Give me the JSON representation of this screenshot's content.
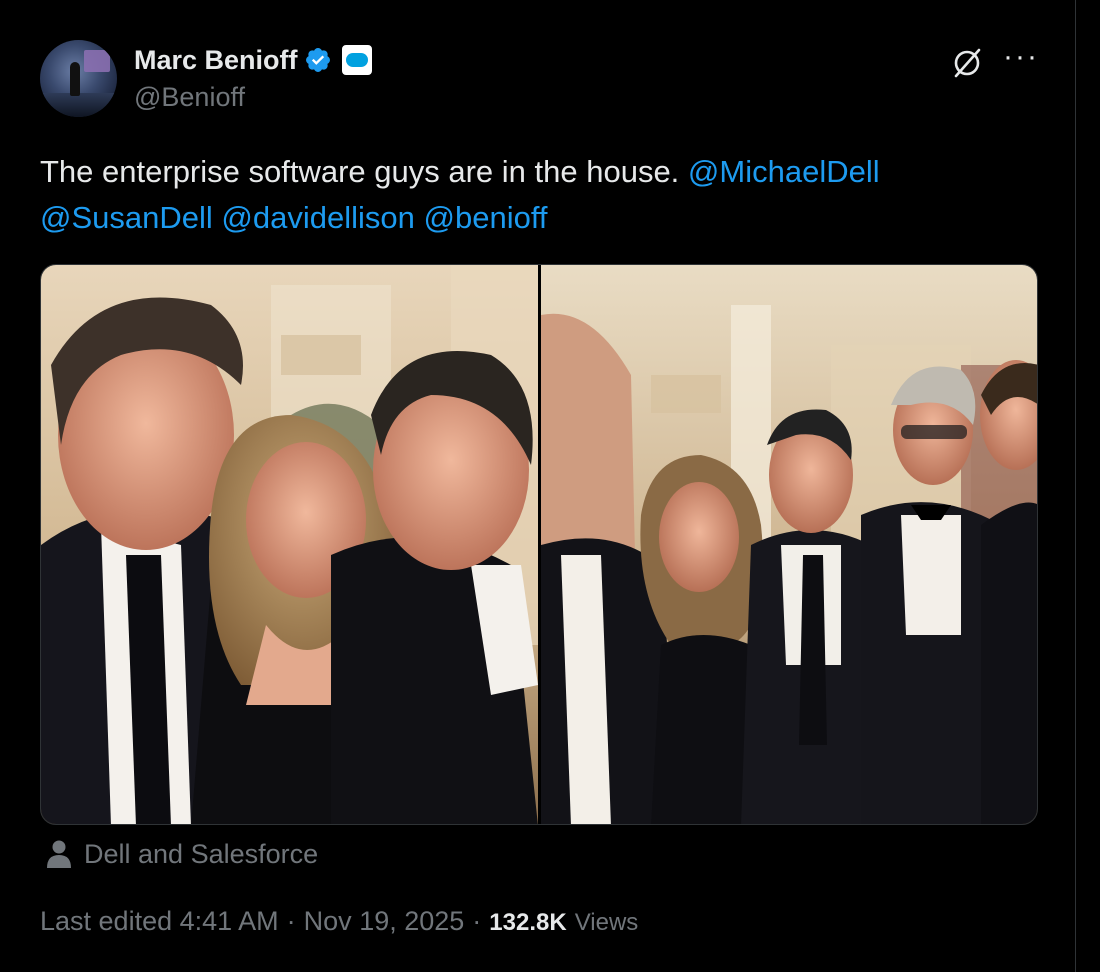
{
  "author": {
    "name": "Marc Benioff",
    "handle": "@Benioff",
    "verified_icon": "verified-badge-icon",
    "affiliate_badge": "salesforce-logo"
  },
  "post": {
    "text_prefix": "The enterprise software guys are in the house.  ",
    "mentions": [
      "@MichaelDell",
      "@SusanDell",
      "@davidellison",
      "@benioff"
    ]
  },
  "media": {
    "photo_count": 2,
    "tagged_people_icon": "person-icon",
    "tagged_label": "Dell and Salesforce"
  },
  "meta": {
    "edited_label": "Last edited 4:41 AM",
    "separator": "·",
    "date": "Nov 19, 2025",
    "views_count": "132.8K",
    "views_label": "Views"
  },
  "actions": {
    "grok_icon": "grok-icon",
    "more_icon": "more-horizontal-icon",
    "more_label": "···"
  },
  "colors": {
    "background": "#000000",
    "text": "#e7e9ea",
    "secondary": "#71767b",
    "link": "#1d9bf0",
    "verified": "#1d9bf0"
  }
}
